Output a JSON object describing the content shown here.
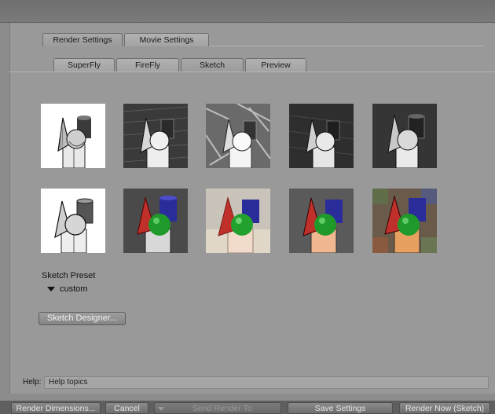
{
  "tabs_primary": [
    {
      "label": "Render Settings",
      "active": true
    },
    {
      "label": "Movie Settings",
      "active": false
    }
  ],
  "tabs_secondary": [
    {
      "label": "SuperFly",
      "active": false
    },
    {
      "label": "FireFly",
      "active": false
    },
    {
      "label": "Sketch",
      "active": true
    },
    {
      "label": "Preview",
      "active": false
    }
  ],
  "sketch_preset": {
    "label": "Sketch Preset",
    "value": "custom",
    "designer_button": "Sketch Designer..."
  },
  "help": {
    "label": "Help:",
    "value": "Help topics"
  },
  "bottom_buttons": {
    "render_dimensions": "Render Dimensions...",
    "cancel": "Cancel",
    "send_render_to": "Send Render To",
    "save_settings": "Save Settings",
    "render_now": "Render Now (Sketch)"
  },
  "colors": {
    "cone": "#c0302a",
    "cylinder": "#2a2c9a",
    "sphere": "#1f9a2a",
    "block": "#d8d8d8"
  }
}
